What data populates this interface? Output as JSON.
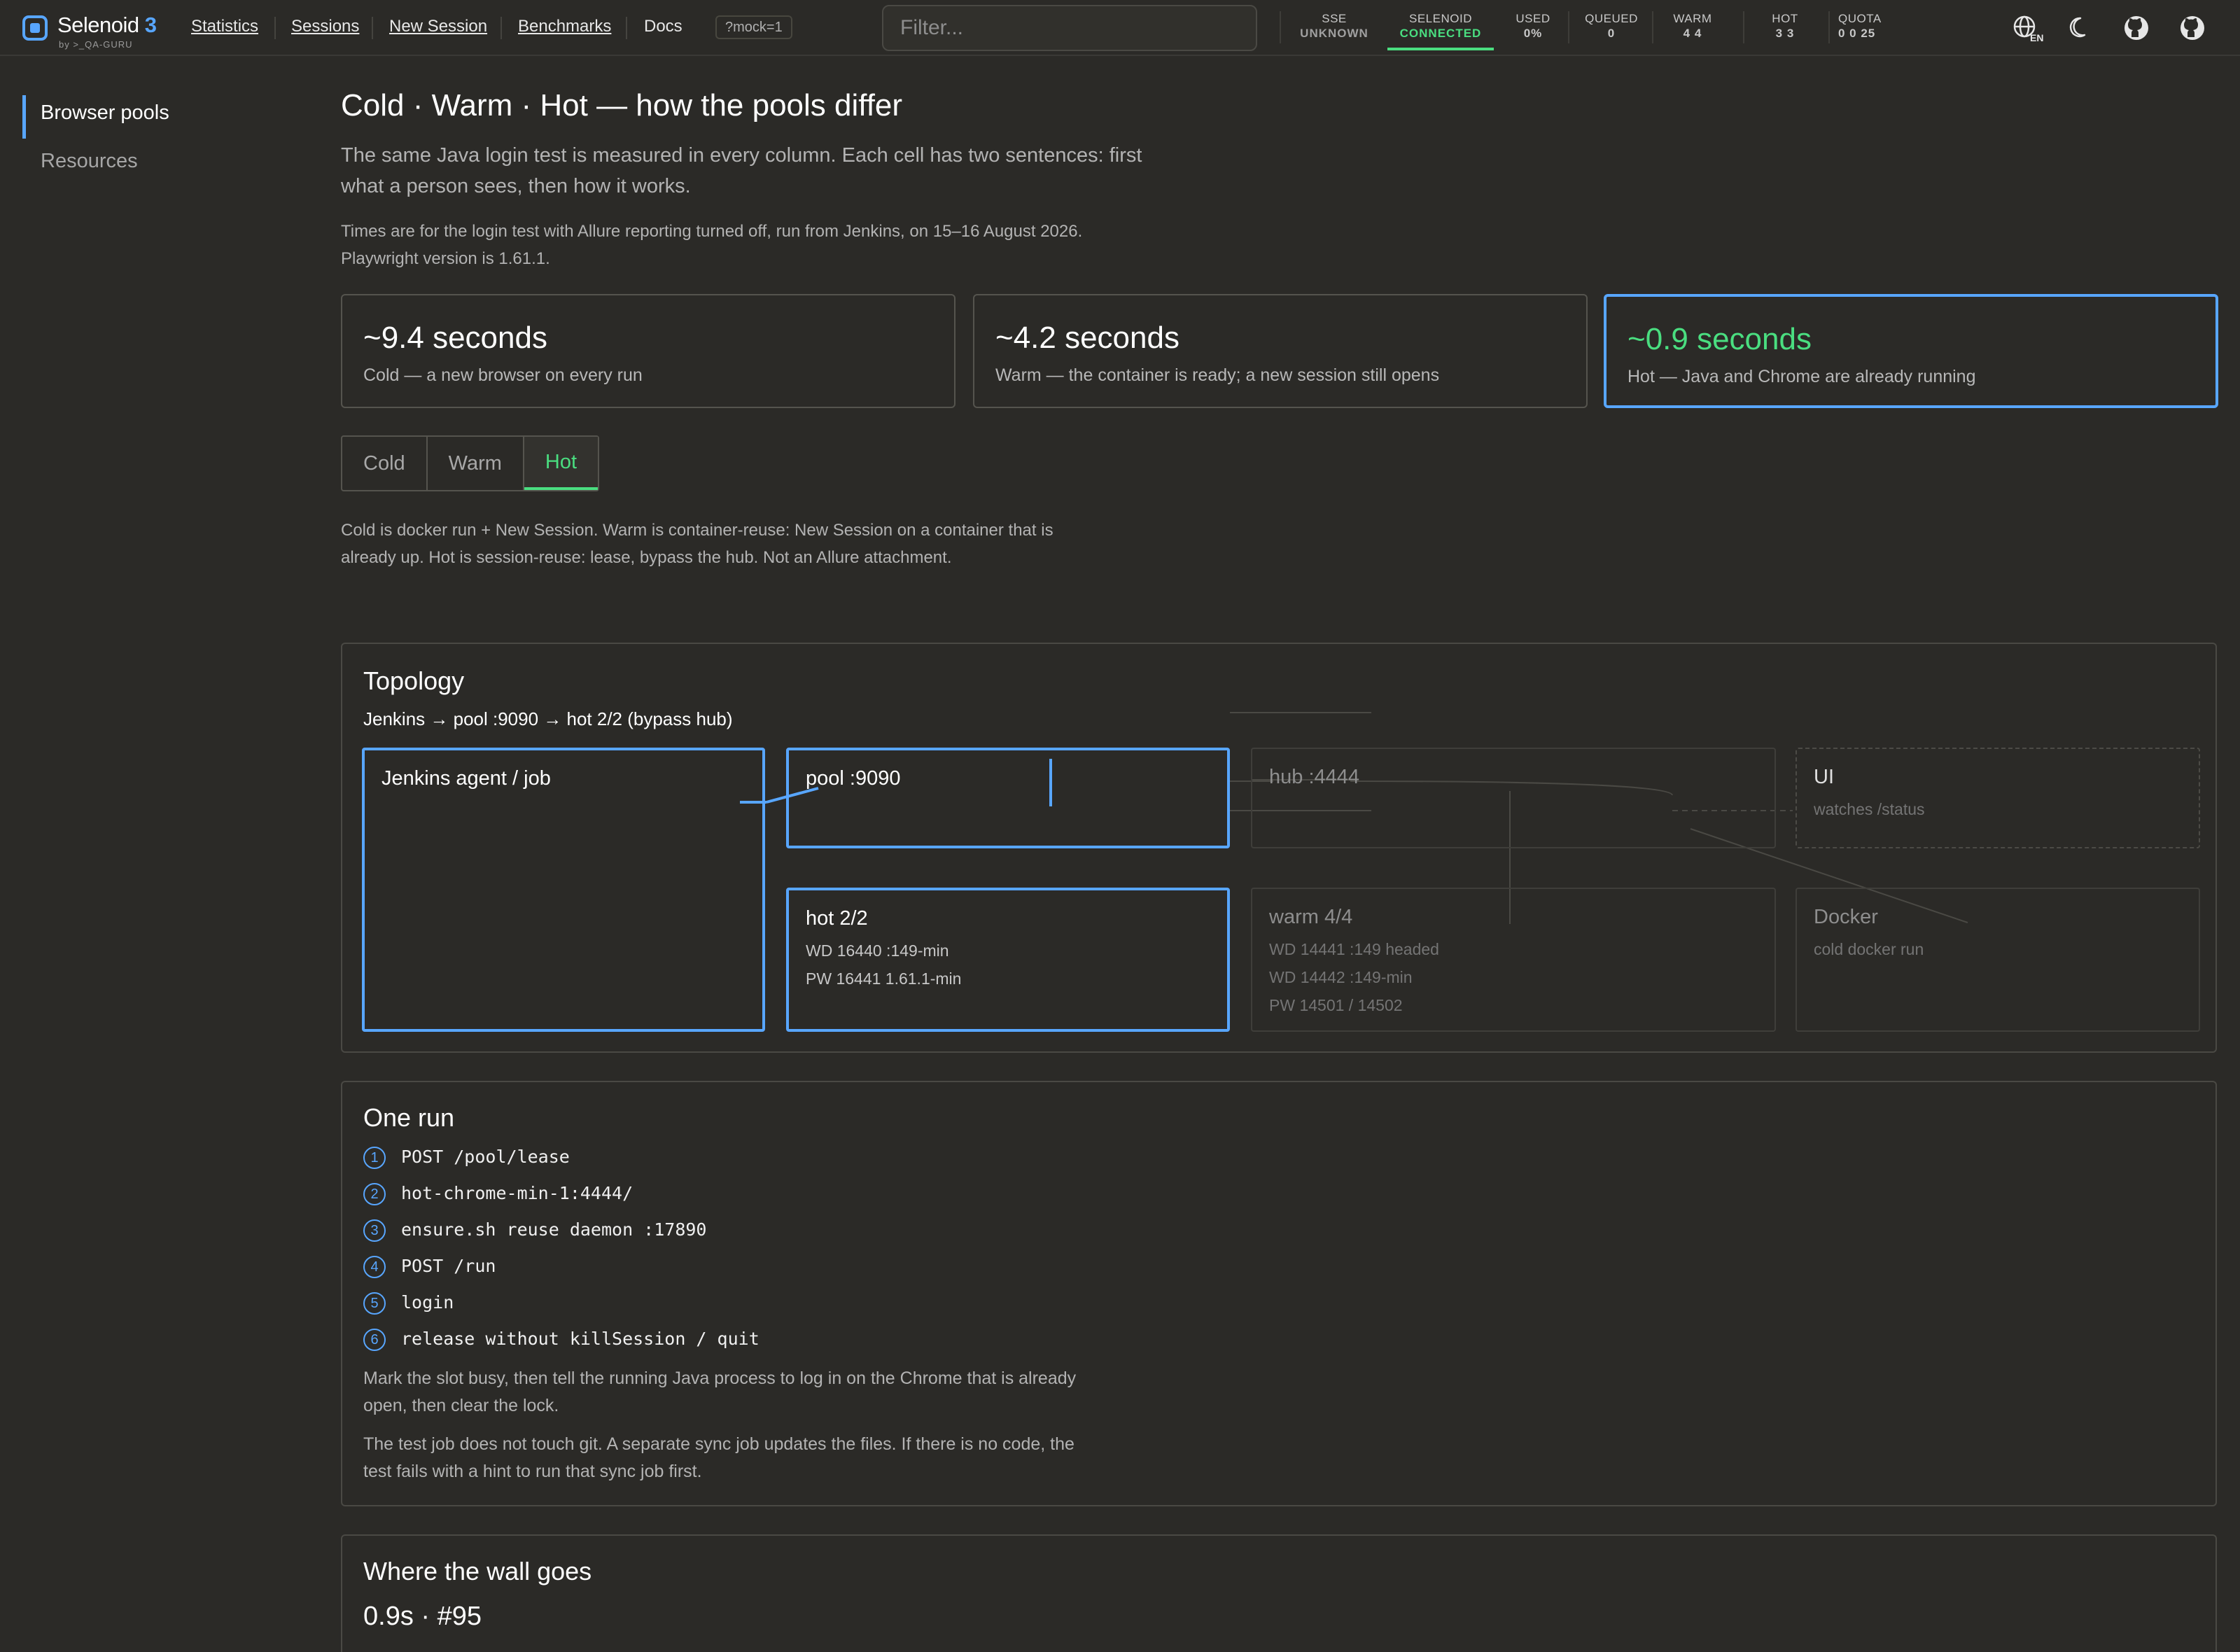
{
  "app": {
    "name": "Selenoid",
    "version": "3",
    "by": "by >_QA-GURU"
  },
  "nav": {
    "items": [
      "Statistics",
      "Sessions",
      "New Session",
      "Benchmarks",
      "Docs"
    ],
    "mock_chip": "?mock=1",
    "filter_placeholder": "Filter..."
  },
  "status": {
    "sse": {
      "label": "SSE",
      "value": "UNKNOWN"
    },
    "selenoid": {
      "label": "SELENOID",
      "value": "CONNECTED"
    },
    "used": {
      "label": "USED",
      "value": "0%"
    },
    "queued": {
      "label": "QUEUED",
      "value": "0"
    },
    "warm": {
      "label": "WARM",
      "value": "4 4"
    },
    "hot": {
      "label": "HOT",
      "value": "3 3"
    },
    "quota": {
      "label": "QUOTA",
      "value": "0 0 25"
    },
    "lang": "EN",
    "colors": {
      "accent": "#58a6ff",
      "success": "#4ade80",
      "background": "#2b2a27"
    }
  },
  "icons": [
    "globe-icon",
    "moon-icon",
    "github-icon",
    "github-icon"
  ],
  "sidebar": {
    "items": [
      {
        "label": "Browser pools",
        "active": true
      },
      {
        "label": "Resources",
        "active": false
      }
    ]
  },
  "main": {
    "title": "Cold · Warm · Hot — how the pools differ",
    "lead": "The same Java login test is measured in every column. Each cell has two sentences: first what a person sees, then how it works.",
    "note": "Times are for the login test with Allure reporting turned off, run from Jenkins, on 15–16 August 2026. Playwright version is 1.61.1.",
    "cards": [
      {
        "time": "~9.4 seconds",
        "desc": "Cold — a new browser on every run"
      },
      {
        "time": "~4.2 seconds",
        "desc": "Warm — the container is ready; a new session still opens"
      },
      {
        "time": "~0.9 seconds",
        "desc": "Hot — Java and Chrome are already running"
      }
    ],
    "tabs": [
      "Cold",
      "Warm",
      "Hot"
    ],
    "active_tab": "Hot",
    "explain": "Cold is docker run + New Session. Warm is container-reuse: New Session on a container that is already up. Hot is session-reuse: lease, bypass the hub. Not an Allure attachment."
  },
  "topology": {
    "title": "Topology",
    "route": "Jenkins → pool :9090 → hot 2/2 (bypass hub)",
    "nodes": {
      "jenkins": {
        "title": "Jenkins agent / job"
      },
      "pool": {
        "title": "pool :9090"
      },
      "hub": {
        "title": "hub :4444"
      },
      "ui": {
        "title": "UI",
        "sub": "watches /status"
      },
      "hot": {
        "title": "hot 2/2",
        "lines": [
          "WD 16440 :149-min",
          "PW 16441 1.61.1-min"
        ]
      },
      "warm": {
        "title": "warm 4/4",
        "lines": [
          "WD 14441 :149 headed",
          "WD 14442 :149-min",
          "PW 14501 / 14502"
        ]
      },
      "docker": {
        "title": "Docker",
        "sub": "cold docker run"
      }
    }
  },
  "run": {
    "title": "One run",
    "steps": [
      {
        "n": "1",
        "text": "POST /pool/lease"
      },
      {
        "n": "2",
        "text": "hot-chrome-min-1:4444/"
      },
      {
        "n": "3",
        "text": "ensure.sh reuse daemon :17890"
      },
      {
        "n": "4",
        "text": "POST /run"
      },
      {
        "n": "5",
        "text": "login"
      },
      {
        "n": "6",
        "text": "release without killSession / quit"
      }
    ],
    "p1": "Mark the slot busy, then tell the running Java process to log in on the Chrome that is already open, then clear the lock.",
    "p2": "The test job does not touch git. A separate sync job updates the files. If there is no code, the test fails with a hint to run that sync job first."
  },
  "wall": {
    "title": "Where the wall goes",
    "value": "0.9s · #95"
  }
}
